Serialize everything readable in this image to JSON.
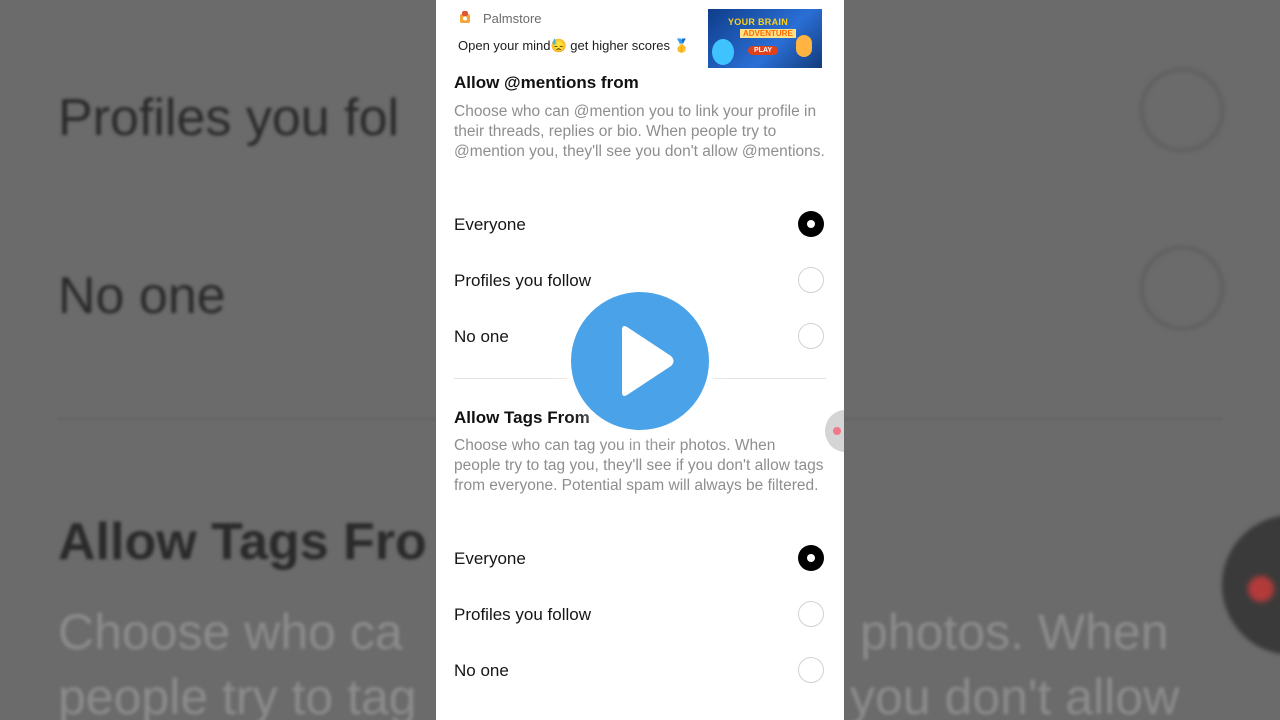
{
  "ad": {
    "brand": "Palmstore",
    "text": "Open your mind😓 get higher scores 🥇",
    "banner_title": "YOUR BRAIN",
    "banner_sub": "ADVENTURE",
    "banner_button": "PLAY"
  },
  "mentions": {
    "title": "Allow @mentions from",
    "description": "Choose who can @mention you to link your profile in their threads, replies or bio. When people try to @mention you, they'll see you don't allow @mentions.",
    "options": [
      {
        "label": "Everyone",
        "selected": true
      },
      {
        "label": "Profiles you follow",
        "selected": false
      },
      {
        "label": "No one",
        "selected": false
      }
    ]
  },
  "tags": {
    "title": "Allow Tags From",
    "description": "Choose who can tag you in their photos. When people try to tag you, they'll see if you don't allow tags from everyone. Potential spam will always be filtered.",
    "options": [
      {
        "label": "Everyone",
        "selected": true
      },
      {
        "label": "Profiles you follow",
        "selected": false
      },
      {
        "label": "No one",
        "selected": false
      }
    ]
  },
  "background": {
    "line1": "Profiles you fol",
    "line2": "No one",
    "line3": "Allow Tags Fro",
    "line4a": "Choose who ca",
    "line4b": "photos. When",
    "line5a": "people try to tag",
    "line5b": "you don't allow"
  },
  "overlay": {
    "icon": "play-icon",
    "accent": "#4aa3e8"
  }
}
